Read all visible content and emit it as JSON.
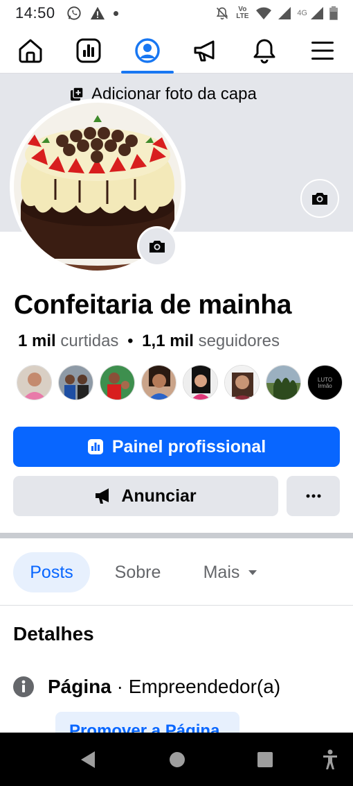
{
  "status_bar": {
    "time": "14:50",
    "icons_left": [
      "whatsapp-icon",
      "warning-icon",
      "dot-icon"
    ],
    "icons_right": [
      "mute-icon",
      "volte-icon",
      "wifi-icon",
      "signal-icon",
      "4g-signal-icon",
      "battery-icon"
    ],
    "volte_label": "Vo LTE",
    "network_label": "4G"
  },
  "nav": {
    "items": [
      "home-icon",
      "dashboard-icon",
      "profile-icon",
      "megaphone-icon",
      "bell-icon",
      "menu-icon"
    ],
    "active": "profile-icon"
  },
  "cover": {
    "add_label": "Adicionar foto da capa"
  },
  "profile": {
    "name": "Confeitaria de mainha",
    "likes_count": "1 mil",
    "likes_label": "curtidas",
    "separator": "•",
    "followers_count": "1,1 mil",
    "followers_label": "seguidores",
    "friend_avatars": [
      {
        "label": ""
      },
      {
        "label": ""
      },
      {
        "label": ""
      },
      {
        "label": ""
      },
      {
        "label": ""
      },
      {
        "label": ""
      },
      {
        "label": ""
      },
      {
        "label": "LUTO Irmão"
      }
    ]
  },
  "actions": {
    "primary_label": "Painel profissional",
    "secondary_label": "Anunciar",
    "more_label": "..."
  },
  "tabs": {
    "posts": "Posts",
    "sobre": "Sobre",
    "mais": "Mais"
  },
  "details": {
    "title": "Detalhes",
    "row_label": "Página",
    "row_separator": "·",
    "row_value": "Empreendedor(a)",
    "promote_label": "Promover a Página"
  },
  "colors": {
    "brand": "#0866ff",
    "cover_bg": "#e4e6eb",
    "tab_active_bg": "#e7f0fd"
  }
}
